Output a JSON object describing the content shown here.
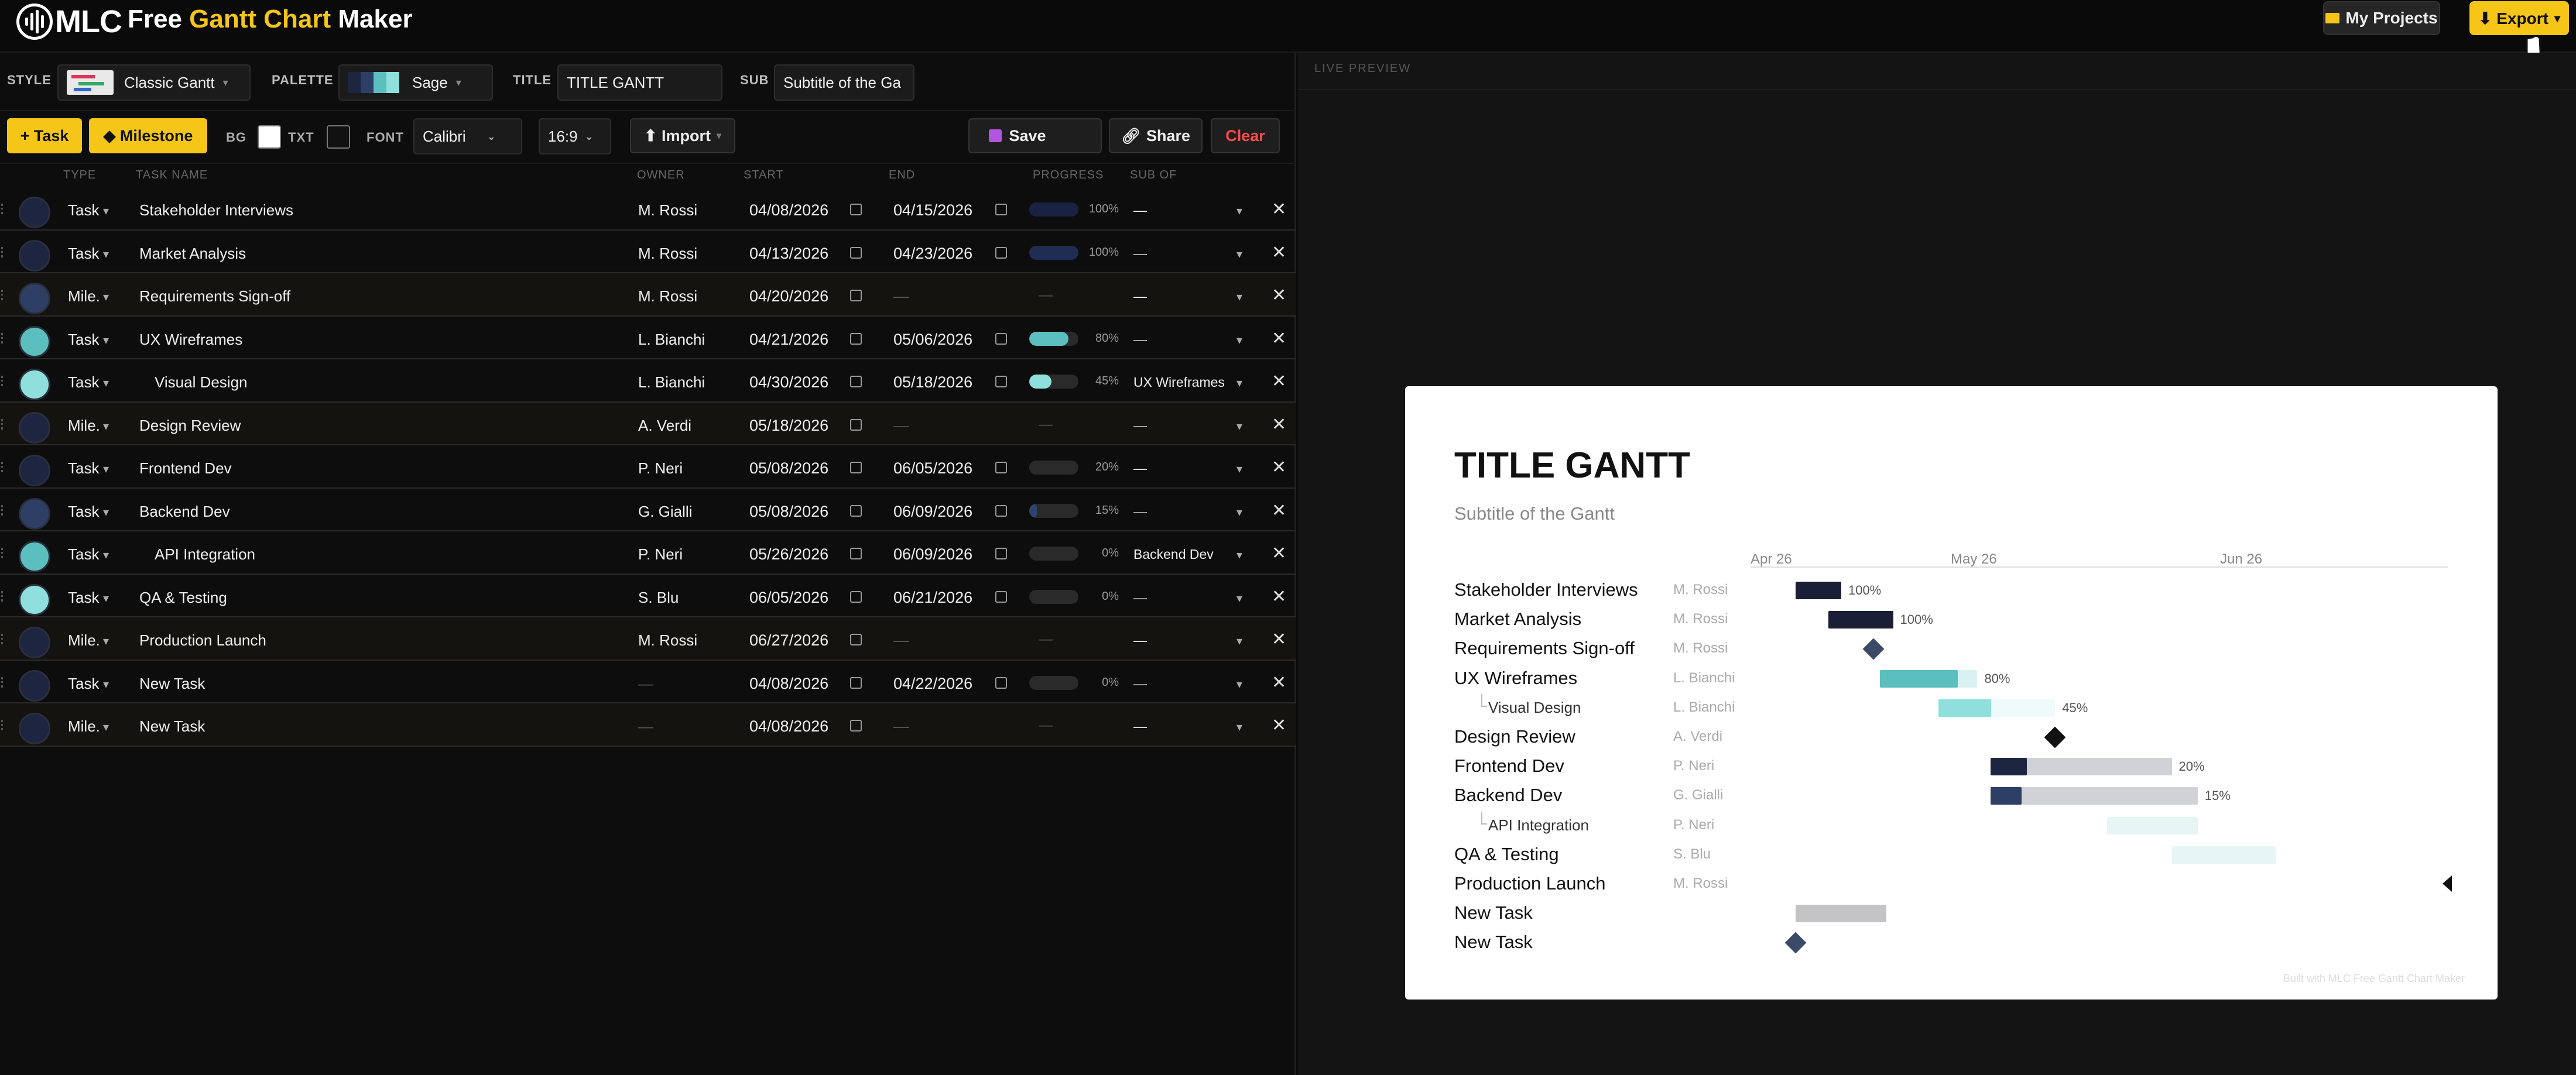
{
  "app": {
    "logo_text": "MLC",
    "title_prefix": "Free ",
    "title_accent": "Gantt Chart",
    "title_suffix": " Maker",
    "my_projects": "My Projects",
    "export": "⬇ Export",
    "export_caret": "▾"
  },
  "stylebar": {
    "style_label": "STYLE",
    "style_value": "Classic Gantt",
    "palette_label": "PALETTE",
    "palette_value": "Sage",
    "palette_colors": [
      "#1d2540",
      "#2e3f66",
      "#5bbfc0",
      "#8fe0dc"
    ],
    "title_label": "TITLE",
    "title_value": "TITLE GANTT",
    "sub_label": "SUB",
    "sub_value": "Subtitle of the Ga"
  },
  "toolbar": {
    "add_task": "+ Task",
    "add_milestone": "◆ Milestone",
    "bg_label": "BG",
    "txt_label": "TXT",
    "font_label": "FONT",
    "font_value": "Calibri",
    "ratio_value": "16:9",
    "import": "⬆ Import",
    "save": "Save",
    "share": "Share",
    "clear": "Clear",
    "bg_color": "#ffffff",
    "txt_color": "#111111"
  },
  "columns": {
    "type": "TYPE",
    "name": "TASK NAME",
    "owner": "OWNER",
    "start": "START",
    "end": "END",
    "progress": "PROGRESS",
    "sub_of": "SUB OF"
  },
  "tasks": [
    {
      "type": "Task",
      "name": "Stakeholder Interviews",
      "owner": "M. Rossi",
      "start": "04/08/2026",
      "end": "04/15/2026",
      "progress": 100,
      "pct": "100%",
      "sub_of": "—",
      "color": "#1d2540",
      "fill": "#1a2244",
      "indent": false
    },
    {
      "type": "Task",
      "name": "Market Analysis",
      "owner": "M. Rossi",
      "start": "04/13/2026",
      "end": "04/23/2026",
      "progress": 100,
      "pct": "100%",
      "sub_of": "—",
      "color": "#1d2540",
      "fill": "#1f2d52",
      "indent": false
    },
    {
      "type": "Mile.",
      "name": "Requirements Sign-off",
      "owner": "M. Rossi",
      "start": "04/20/2026",
      "end": "—",
      "progress": null,
      "pct": "—",
      "sub_of": "—",
      "color": "#2e3f66",
      "fill": "",
      "indent": false
    },
    {
      "type": "Task",
      "name": "UX Wireframes",
      "owner": "L. Bianchi",
      "start": "04/21/2026",
      "end": "05/06/2026",
      "progress": 80,
      "pct": "80%",
      "sub_of": "—",
      "color": "#5bbfc0",
      "fill": "#5bbfc0",
      "indent": false
    },
    {
      "type": "Task",
      "name": "Visual Design",
      "owner": "L. Bianchi",
      "start": "04/30/2026",
      "end": "05/18/2026",
      "progress": 45,
      "pct": "45%",
      "sub_of": "UX Wireframes",
      "color": "#8fe0dc",
      "fill": "#8fe0dc",
      "indent": true
    },
    {
      "type": "Mile.",
      "name": "Design Review",
      "owner": "A. Verdi",
      "start": "05/18/2026",
      "end": "—",
      "progress": null,
      "pct": "—",
      "sub_of": "—",
      "color": "#1d2540",
      "fill": "",
      "indent": false
    },
    {
      "type": "Task",
      "name": "Frontend Dev",
      "owner": "P. Neri",
      "start": "05/08/2026",
      "end": "06/05/2026",
      "progress": 20,
      "pct": "20%",
      "sub_of": "—",
      "color": "#1d2540",
      "fill": "#2a2a2a",
      "indent": false
    },
    {
      "type": "Task",
      "name": "Backend Dev",
      "owner": "G. Gialli",
      "start": "05/08/2026",
      "end": "06/09/2026",
      "progress": 15,
      "pct": "15%",
      "sub_of": "—",
      "color": "#2e3f66",
      "fill": "#2e4470",
      "indent": false
    },
    {
      "type": "Task",
      "name": "API Integration",
      "owner": "P. Neri",
      "start": "05/26/2026",
      "end": "06/09/2026",
      "progress": 0,
      "pct": "0%",
      "sub_of": "Backend Dev",
      "color": "#5bbfc0",
      "fill": "",
      "indent": true
    },
    {
      "type": "Task",
      "name": "QA & Testing",
      "owner": "S. Blu",
      "start": "06/05/2026",
      "end": "06/21/2026",
      "progress": 0,
      "pct": "0%",
      "sub_of": "—",
      "color": "#8fe0dc",
      "fill": "",
      "indent": false
    },
    {
      "type": "Mile.",
      "name": "Production Launch",
      "owner": "M. Rossi",
      "start": "06/27/2026",
      "end": "—",
      "progress": null,
      "pct": "—",
      "sub_of": "—",
      "color": "#1d2540",
      "fill": "",
      "indent": false
    },
    {
      "type": "Task",
      "name": "New Task",
      "owner": "—",
      "start": "04/08/2026",
      "end": "04/22/2026",
      "progress": 0,
      "pct": "0%",
      "sub_of": "—",
      "color": "#1d2540",
      "fill": "",
      "indent": false
    },
    {
      "type": "Mile.",
      "name": "New Task",
      "owner": "—",
      "start": "04/08/2026",
      "end": "—",
      "progress": null,
      "pct": "—",
      "sub_of": "—",
      "color": "#1d2540",
      "fill": "",
      "indent": false
    }
  ],
  "preview": {
    "header": "LIVE PREVIEW",
    "title": "TITLE GANTT",
    "subtitle": "Subtitle of the Gantt",
    "months": [
      "Apr 26",
      "May 26",
      "Jun 26"
    ],
    "credit": "Built with MLC Free Gantt Chart Maker",
    "bar_colors": [
      "#1a1f36",
      "#1a1f36",
      "#3b4a66",
      "#5bbfc0",
      "#8fe0dc",
      "#111111",
      "#1d2540",
      "#2e3f66",
      "#8fe0dc",
      "#8fe0dc",
      "#111111",
      "#bbbbbc",
      "#3b4a66"
    ]
  }
}
